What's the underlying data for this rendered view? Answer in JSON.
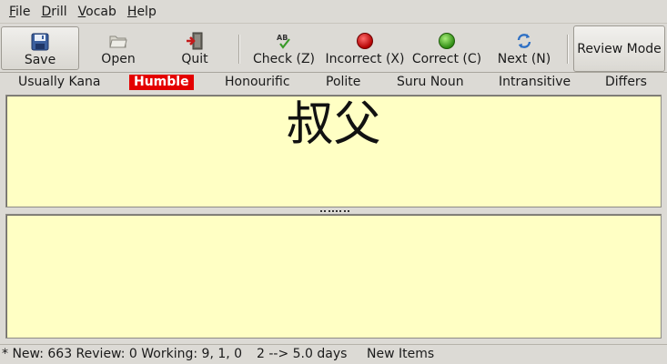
{
  "menu": {
    "file": {
      "ul": "F",
      "rest": "ile"
    },
    "drill": {
      "ul": "D",
      "rest": "rill"
    },
    "vocab": {
      "ul": "V",
      "rest": "ocab"
    },
    "help": {
      "ul": "H",
      "rest": "elp"
    }
  },
  "toolbar": {
    "save": {
      "label": "Save",
      "icon": "floppy-disk-icon"
    },
    "open": {
      "label": "Open",
      "icon": "folder-open-icon"
    },
    "quit": {
      "label": "Quit",
      "icon": "exit-door-icon"
    },
    "check": {
      "label": "Check (Z)",
      "icon": "spell-check-icon"
    },
    "incorrect": {
      "label": "Incorrect (X)",
      "icon": "red-circle-icon",
      "color": "#d40000"
    },
    "correct": {
      "label": "Correct (C)",
      "icon": "green-circle-icon",
      "color": "#3fae1f"
    },
    "next": {
      "label": "Next (N)",
      "icon": "refresh-arrows-icon"
    },
    "review_mode": "Review Mode"
  },
  "tags": [
    {
      "label": "Usually Kana",
      "active": false
    },
    {
      "label": "Humble",
      "active": true
    },
    {
      "label": "Honourific",
      "active": false
    },
    {
      "label": "Polite",
      "active": false
    },
    {
      "label": "Suru Noun",
      "active": false
    },
    {
      "label": "Intransitive",
      "active": false
    },
    {
      "label": "Differs",
      "active": false
    }
  ],
  "colors": {
    "pane_bg": "#ffffc4",
    "active_tag_bg": "#e40000"
  },
  "question": {
    "kanji": "叔父"
  },
  "answer": {
    "text": ""
  },
  "status": {
    "counts": "* New: 663 Review: 0 Working: 9, 1, 0",
    "interval": "2 --> 5.0 days",
    "mode": "New Items"
  }
}
